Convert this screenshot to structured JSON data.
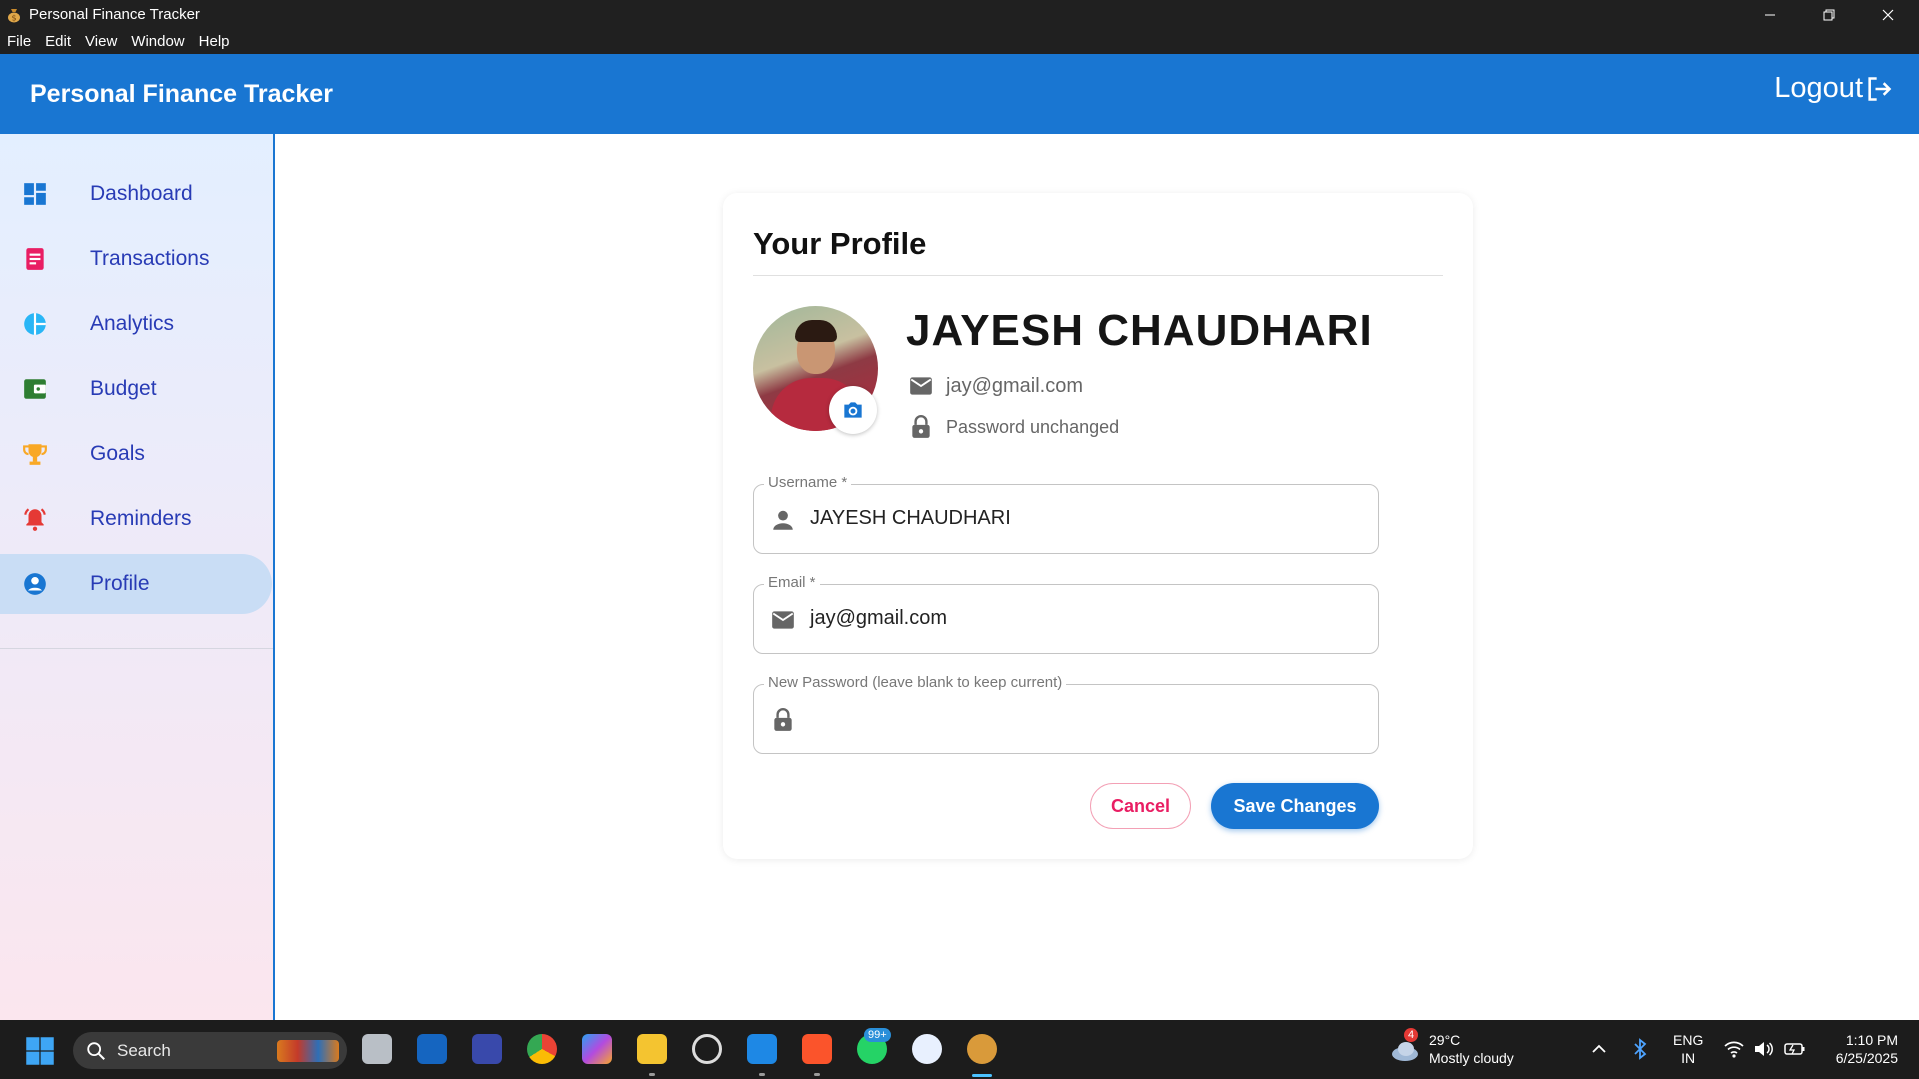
{
  "window": {
    "title": "Personal Finance Tracker",
    "menu": [
      "File",
      "Edit",
      "View",
      "Window",
      "Help"
    ]
  },
  "header": {
    "brand": "Personal Finance Tracker",
    "logout_label": "Logout"
  },
  "sidebar": {
    "items": [
      {
        "label": "Dashboard",
        "icon": "dashboard-icon",
        "color": "#1976d2"
      },
      {
        "label": "Transactions",
        "icon": "receipt-icon",
        "color": "#e91e63"
      },
      {
        "label": "Analytics",
        "icon": "pie-chart-icon",
        "color": "#29b6f6"
      },
      {
        "label": "Budget",
        "icon": "wallet-icon",
        "color": "#2e7d32"
      },
      {
        "label": "Goals",
        "icon": "trophy-icon",
        "color": "#f9a825"
      },
      {
        "label": "Reminders",
        "icon": "bell-alert-icon",
        "color": "#e53935"
      },
      {
        "label": "Profile",
        "icon": "account-circle-icon",
        "color": "#1976d2"
      }
    ],
    "active": "Profile"
  },
  "profile": {
    "heading": "Your Profile",
    "name": "JAYESH CHAUDHARI",
    "email": "jay@gmail.com",
    "password_status": "Password unchanged"
  },
  "form": {
    "username_label": "Username *",
    "username_value": "JAYESH CHAUDHARI",
    "email_label": "Email *",
    "email_value": "jay@gmail.com",
    "password_label": "New Password (leave blank to keep current)",
    "password_value": "",
    "cancel_label": "Cancel",
    "save_label": "Save Changes"
  },
  "taskbar": {
    "search_label": "Search",
    "weather_badge": "4",
    "temperature": "29°C",
    "weather": "Mostly cloudy",
    "lang_top": "ENG",
    "lang_bottom": "IN",
    "time": "1:10 PM",
    "date": "6/25/2025",
    "whatsapp_badge": "99+"
  }
}
